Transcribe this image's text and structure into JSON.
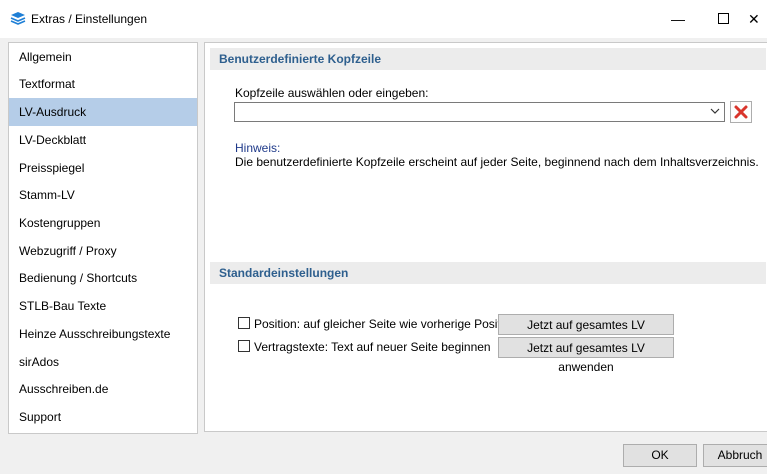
{
  "window": {
    "title": "Extras / Einstellungen",
    "minimize": "—",
    "close": "✕"
  },
  "sidebar": {
    "items": [
      {
        "label": "Allgemein"
      },
      {
        "label": "Textformat"
      },
      {
        "label": "LV-Ausdruck",
        "selected": true
      },
      {
        "label": "LV-Deckblatt"
      },
      {
        "label": "Preisspiegel"
      },
      {
        "label": "Stamm-LV"
      },
      {
        "label": "Kostengruppen"
      },
      {
        "label": "Webzugriff / Proxy"
      },
      {
        "label": "Bedienung / Shortcuts"
      },
      {
        "label": "STLB-Bau Texte"
      },
      {
        "label": "Heinze Ausschreibungstexte"
      },
      {
        "label": "sirAdos"
      },
      {
        "label": "Ausschreiben.de"
      },
      {
        "label": "Support"
      }
    ]
  },
  "header_section": {
    "title": "Benutzerdefinierte Kopfzeile",
    "field_label": "Kopfzeile auswählen oder eingeben:",
    "field_value": "",
    "hint_title": "Hinweis:",
    "hint_text": "Die benutzerdefinierte Kopfzeile erscheint auf jeder Seite, beginnend nach dem Inhaltsverzeichnis."
  },
  "defaults_section": {
    "title": "Standardeinstellungen",
    "options": [
      {
        "label": "Position: auf gleicher Seite wie vorherige Position",
        "checked": false,
        "button": "Jetzt auf gesamtes LV anwenden"
      },
      {
        "label": "Vertragstexte: Text auf neuer Seite beginnen",
        "checked": false,
        "button": "Jetzt auf gesamtes LV anwenden"
      }
    ]
  },
  "footer": {
    "ok": "OK",
    "cancel": "Abbruch"
  },
  "colors": {
    "selected_bg": "#b5cde8",
    "section_title": "#2e5f8e",
    "hint_title": "#1f3a8a",
    "delete_icon": "#d9342b",
    "app_icon": "#1e7fd6"
  }
}
